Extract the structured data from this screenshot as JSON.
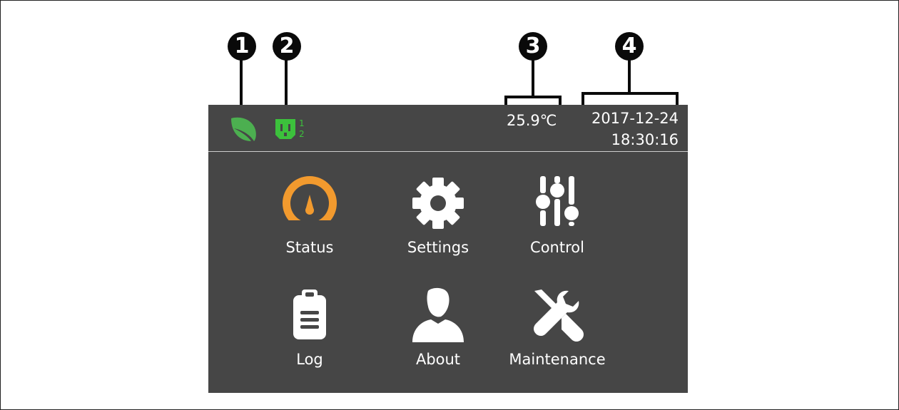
{
  "callouts": [
    "1",
    "2",
    "3",
    "4"
  ],
  "statusbar": {
    "eco_icon": "leaf-icon",
    "outlet_icon": "power-outlet-icon",
    "outlet_numbers": [
      "1",
      "2"
    ],
    "temperature": "25.9℃",
    "date": "2017-12-24",
    "time": "18:30:16"
  },
  "menu": {
    "items": [
      {
        "label": "Status",
        "icon": "gauge-icon"
      },
      {
        "label": "Settings",
        "icon": "gear-icon"
      },
      {
        "label": "Control",
        "icon": "sliders-icon"
      },
      {
        "label": "Log",
        "icon": "clipboard-icon"
      },
      {
        "label": "About",
        "icon": "person-icon"
      },
      {
        "label": "Maintenance",
        "icon": "tools-icon"
      }
    ]
  },
  "colors": {
    "screen_bg": "#464646",
    "eco_green": "#4caf50",
    "outlet_green": "#3cc13c",
    "gauge_orange": "#f29a2e",
    "callout_black": "#0a0a0a"
  }
}
